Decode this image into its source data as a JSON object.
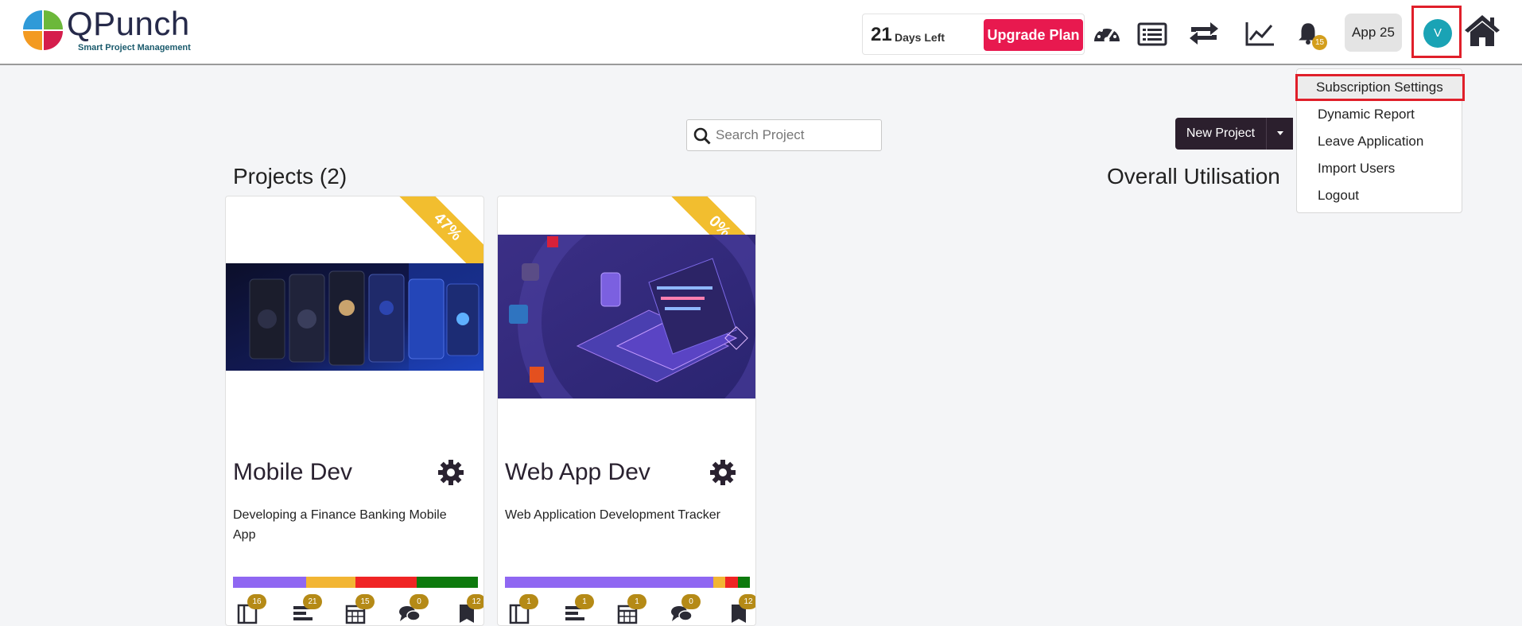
{
  "brand": {
    "name": "QPunch",
    "tagline": "Smart Project Management"
  },
  "trial": {
    "days": "21",
    "days_label": "Days Left",
    "upgrade_label": "Upgrade Plan"
  },
  "toolbar": {
    "icons": [
      "dashboard-icon",
      "list-icon",
      "sync-icon",
      "chart-line-icon",
      "bell-icon",
      "home-icon"
    ],
    "notifications": "15",
    "app_label": "App 25",
    "avatar_initial": "V"
  },
  "user_menu": {
    "items": [
      "Subscription Settings",
      "Dynamic Report",
      "Leave Application",
      "Import Users",
      "Logout"
    ],
    "active_index": 0
  },
  "search": {
    "placeholder": "Search Project"
  },
  "new_project": {
    "label": "New Project"
  },
  "projects": {
    "title": "Projects (2)",
    "utilisation_title": "Overall Utilisation",
    "items": [
      {
        "percent": "47%",
        "title": "Mobile Dev",
        "description": "Developing a Finance Banking Mobile App",
        "progress": [
          {
            "fraction": 0.3,
            "color": "#8f67f2"
          },
          {
            "fraction": 0.2,
            "color": "#f2b533"
          },
          {
            "fraction": 0.25,
            "color": "#f02424"
          },
          {
            "fraction": 0.25,
            "color": "#0d7a0d"
          }
        ],
        "stats": [
          "16",
          "21",
          "15",
          "0",
          "12"
        ]
      },
      {
        "percent": "0%",
        "title": "Web App Dev",
        "description": "Web Application Development Tracker",
        "progress": [
          {
            "fraction": 0.85,
            "color": "#8f67f2"
          },
          {
            "fraction": 0.05,
            "color": "#f2b533"
          },
          {
            "fraction": 0.05,
            "color": "#f02424"
          },
          {
            "fraction": 0.05,
            "color": "#0d7a0d"
          }
        ],
        "stats": [
          "1",
          "1",
          "1",
          "0",
          "12"
        ]
      }
    ]
  },
  "stat_icons": [
    "book-icon",
    "tasks-icon",
    "calendar-icon",
    "comments-icon",
    "bookmark-icon"
  ]
}
